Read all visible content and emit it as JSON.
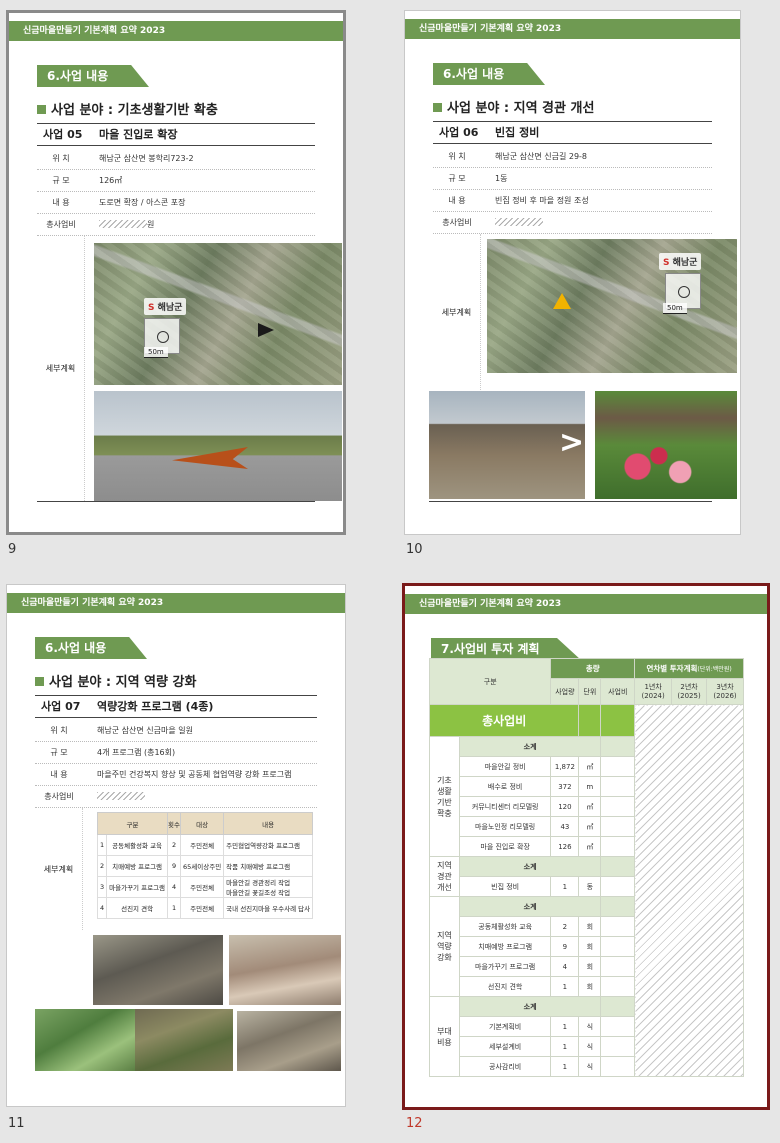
{
  "header_text": "신금마을만들기 기본계획 요약  2023",
  "thumbnails": [
    {
      "page_number": "9",
      "section": "6.사업 내용",
      "field": "사업 분야 : 기초생활기반 확충",
      "project_no": "사업 05",
      "project_name": "마을 진입로 확장",
      "rows": [
        {
          "label": "위    치",
          "value": "해남군 삼산면 봉학리723-2"
        },
        {
          "label": "규    모",
          "value": "126㎡"
        },
        {
          "label": "내    용",
          "value": "도로면 확장 / 아스콘 포장"
        },
        {
          "label": "총사업비",
          "value": "원"
        }
      ],
      "detail_label": "세부계획",
      "map_logo": "해남군",
      "map_scale": "50m"
    },
    {
      "page_number": "10",
      "section": "6.사업 내용",
      "field": "사업 분야 : 지역 경관 개선",
      "project_no": "사업 06",
      "project_name": "빈집 정비",
      "rows": [
        {
          "label": "위    치",
          "value": "해남군 삼산면 신금길 29-8"
        },
        {
          "label": "규    모",
          "value": "1동"
        },
        {
          "label": "내    용",
          "value": "빈집 정비 후 마을 정원 조성"
        },
        {
          "label": "총사업비",
          "value": ""
        }
      ],
      "detail_label": "세부계획",
      "map_logo": "해남군",
      "map_scale": "50m",
      "compare_symbol": ">"
    },
    {
      "page_number": "11",
      "section": "6.사업 내용",
      "field": "사업 분야 : 지역 역량 강화",
      "project_no": "사업 07",
      "project_name": "역량강화 프로그램 (4종)",
      "rows": [
        {
          "label": "위    치",
          "value": "해남군 삼산면 신금마을 일원"
        },
        {
          "label": "규    모",
          "value": "4개 프로그램 (총16회)"
        },
        {
          "label": "내    용",
          "value": "마을주민 건강복지 향상 및 공동체 협업역량 강화 프로그램"
        },
        {
          "label": "총사업비",
          "value": ""
        }
      ],
      "detail_label": "세부계획",
      "program_table": {
        "headers": [
          "구분",
          "횟수",
          "대상",
          "내용"
        ],
        "rows": [
          [
            "1",
            "공동체활성화 교육",
            "2",
            "주민전체",
            "주민협업역량강화 프로그램"
          ],
          [
            "2",
            "치매예방 프로그램",
            "9",
            "65세이상주민",
            "작품 치매예방 프로그램"
          ],
          [
            "3",
            "마을가꾸기 프로그램",
            "4",
            "주민전체",
            "마을안길 경관정리 작업\n마을안길 꽃길조성 작업"
          ],
          [
            "4",
            "선진지 견학",
            "1",
            "주민전체",
            "국내 선진지마을 우수사례 답사"
          ]
        ]
      }
    },
    {
      "page_number": "12",
      "section": "7.사업비 투자 계획",
      "investment": {
        "col_group": "구분",
        "total_head": "총량",
        "yearly_head": "연차별 투자계획",
        "yearly_unit": "(단위:백만원)",
        "sub_heads": [
          "사업량",
          "단위",
          "사업비"
        ],
        "years": [
          "1년차\n(2024)",
          "2년차\n(2025)",
          "3년차\n(2026)"
        ],
        "grand_total": "총사업비",
        "subtotal_label": "소계",
        "groups": [
          {
            "name": "기초\n생활\n기반\n확충",
            "items": [
              {
                "name": "마을안길 정비",
                "qty": "1,872",
                "unit": "㎡"
              },
              {
                "name": "배수로 정비",
                "qty": "372",
                "unit": "m"
              },
              {
                "name": "커뮤니티센터 리모델링",
                "qty": "120",
                "unit": "㎡"
              },
              {
                "name": "마을노인정 리모델링",
                "qty": "43",
                "unit": "㎡"
              },
              {
                "name": "마을 진입로 확장",
                "qty": "126",
                "unit": "㎡"
              }
            ]
          },
          {
            "name": "지역\n경관\n개선",
            "items": [
              {
                "name": "빈집 정비",
                "qty": "1",
                "unit": "동"
              }
            ]
          },
          {
            "name": "지역\n역량\n강화",
            "items": [
              {
                "name": "공동체활성화 교육",
                "qty": "2",
                "unit": "회"
              },
              {
                "name": "치매예방 프로그램",
                "qty": "9",
                "unit": "회"
              },
              {
                "name": "마을가꾸기 프로그램",
                "qty": "4",
                "unit": "회"
              },
              {
                "name": "선진지 견학",
                "qty": "1",
                "unit": "회"
              }
            ]
          },
          {
            "name": "부대\n비용",
            "items": [
              {
                "name": "기본계획비",
                "qty": "1",
                "unit": "식"
              },
              {
                "name": "세부설계비",
                "qty": "1",
                "unit": "식"
              },
              {
                "name": "공사감리비",
                "qty": "1",
                "unit": "식"
              }
            ]
          }
        ]
      }
    }
  ],
  "colors": {
    "header_green": "#6f9a52",
    "active_page": "#c0392b",
    "selected_border": "#7a1a1a"
  }
}
